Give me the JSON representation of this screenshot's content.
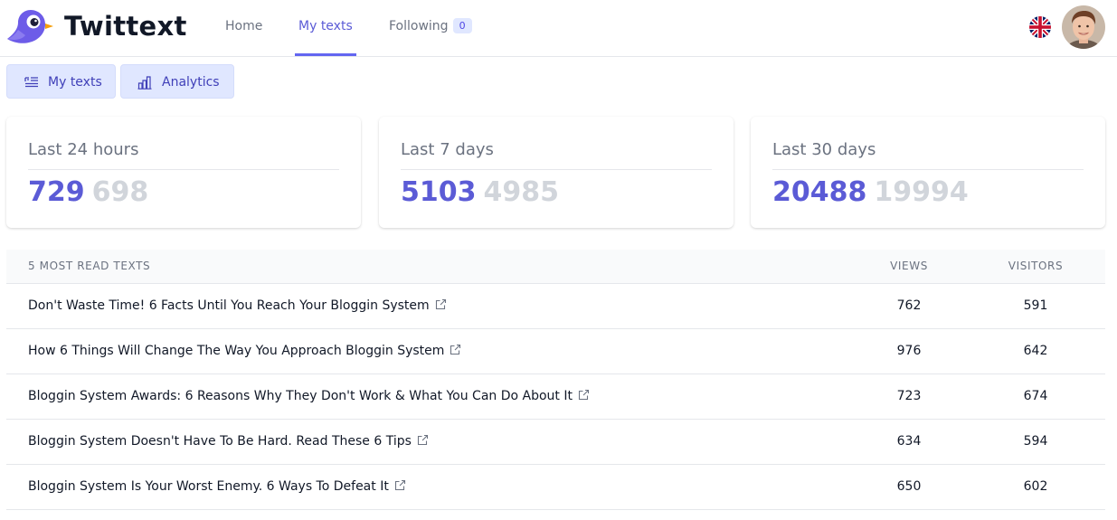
{
  "app": {
    "brand": "Twittext"
  },
  "nav": {
    "home": "Home",
    "my_texts": "My texts",
    "following": "Following",
    "following_count": "0"
  },
  "subtabs": {
    "my_texts": "My texts",
    "analytics": "Analytics"
  },
  "stats": [
    {
      "label": "Last 24 hours",
      "current": "729",
      "previous": "698"
    },
    {
      "label": "Last 7 days",
      "current": "5103",
      "previous": "4985"
    },
    {
      "label": "Last 30 days",
      "current": "20488",
      "previous": "19994"
    }
  ],
  "table": {
    "headers": {
      "title": "5 MOST READ TEXTS",
      "views": "VIEWS",
      "visitors": "VISITORS"
    },
    "rows": [
      {
        "title": "Don't Waste Time! 6 Facts Until You Reach Your Bloggin System",
        "views": "762",
        "visitors": "591"
      },
      {
        "title": "How 6 Things Will Change The Way You Approach Bloggin System",
        "views": "976",
        "visitors": "642"
      },
      {
        "title": "Bloggin System Awards: 6 Reasons Why They Don't Work & What You Can Do About It",
        "views": "723",
        "visitors": "674"
      },
      {
        "title": "Bloggin System Doesn't Have To Be Hard. Read These 6 Tips",
        "views": "634",
        "visitors": "594"
      },
      {
        "title": "Bloggin System Is Your Worst Enemy. 6 Ways To Defeat It",
        "views": "650",
        "visitors": "602"
      }
    ]
  },
  "colors": {
    "accent": "#6366f1",
    "accent_text": "#5b5bd6",
    "muted_value": "#d1d5db",
    "subtab_bg": "#e0e7ff"
  },
  "icons": {
    "logo": "bird-logo-icon",
    "language": "uk-flag-icon",
    "user": "user-avatar",
    "my_texts": "text-list-icon",
    "analytics": "bar-chart-icon",
    "external": "external-link-icon"
  }
}
